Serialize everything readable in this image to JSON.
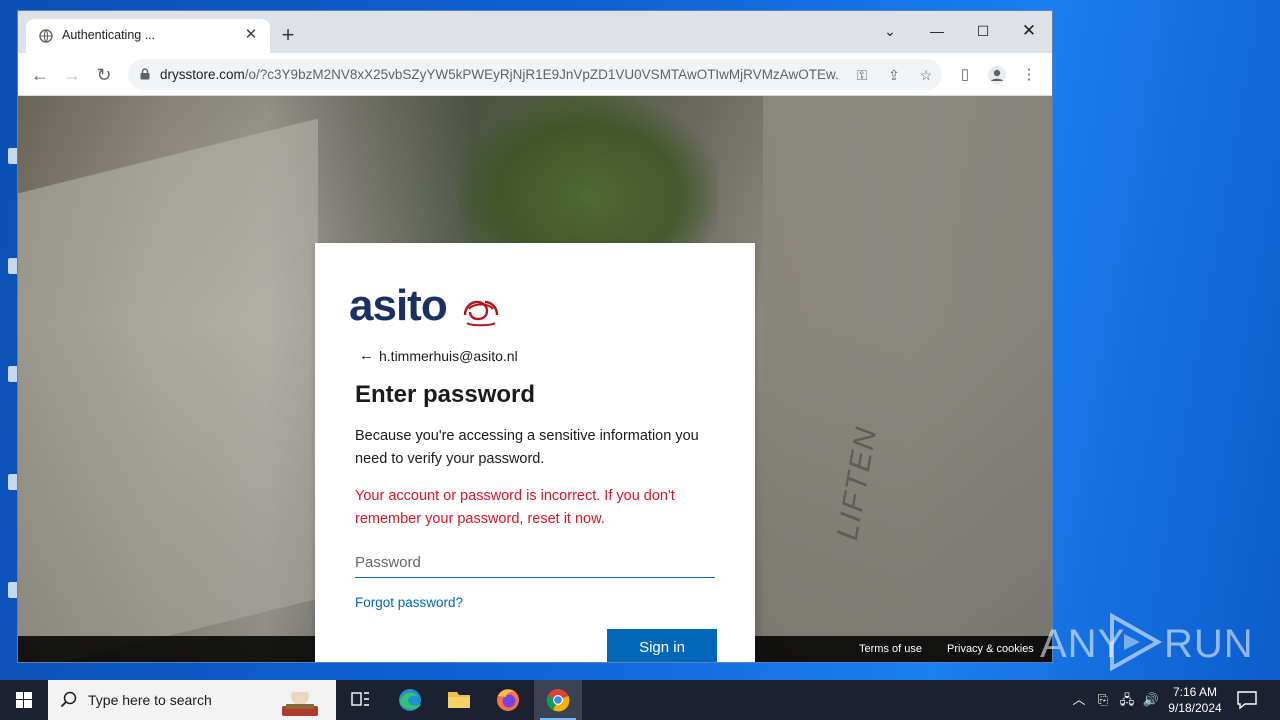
{
  "browser": {
    "tab_title": "Authenticating ...",
    "url_domain": "drysstore.com",
    "url_path": "/o/?c3Y9bzM2NV8xX25vbSZyYW5kPWEyRjNjR1E9JnVpZD1VU0VSMTAwOTIwMjRVMzAwOTEw..."
  },
  "login": {
    "logo_text": "asito",
    "email": "h.timmerhuis@asito.nl",
    "title": "Enter password",
    "description": "Because you're accessing a sensitive information you need to verify your password.",
    "error": "Your account or password is incorrect. If you don't remember your password, reset it now.",
    "password_placeholder": "Password",
    "forgot_link": "Forgot password?",
    "signin_label": "Sign in"
  },
  "page": {
    "wall_text": "LIFTEN",
    "footer_terms": "Terms of use",
    "footer_privacy": "Privacy & cookies"
  },
  "watermark": {
    "left": "ANY",
    "right": "RUN"
  },
  "taskbar": {
    "search_placeholder": "Type here to search",
    "time": "7:16 AM",
    "date": "9/18/2024"
  },
  "colors": {
    "accent": "#0067b8",
    "error": "#e81123",
    "logo": "#1c3163",
    "logo_mark": "#b5121b"
  }
}
